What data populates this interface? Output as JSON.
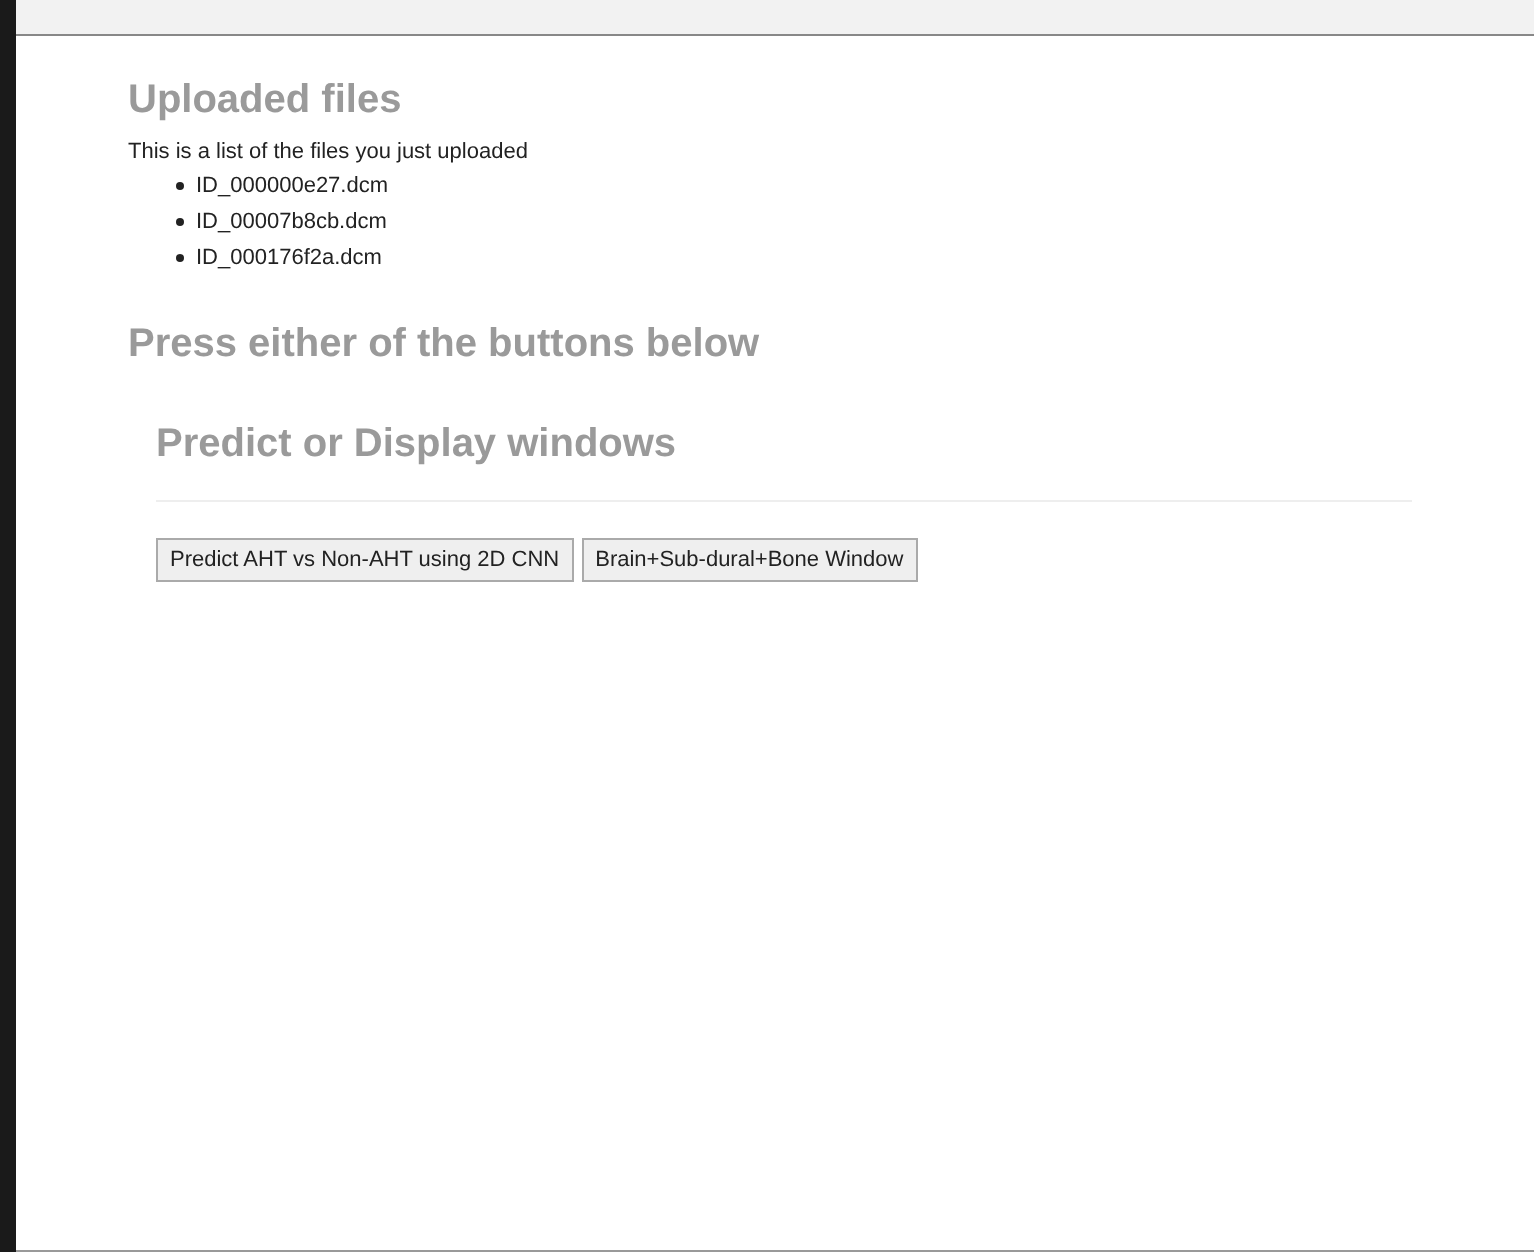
{
  "uploaded": {
    "title": "Uploaded files",
    "intro": "This is a list of the files you just uploaded",
    "files": [
      "ID_000000e27.dcm",
      "ID_00007b8cb.dcm",
      "ID_000176f2a.dcm"
    ]
  },
  "instruction": "Press either of the buttons below",
  "panel": {
    "title": "Predict or Display windows",
    "buttons": [
      "Predict AHT vs Non-AHT using 2D CNN",
      "Brain+Sub-dural+Bone Window"
    ]
  }
}
